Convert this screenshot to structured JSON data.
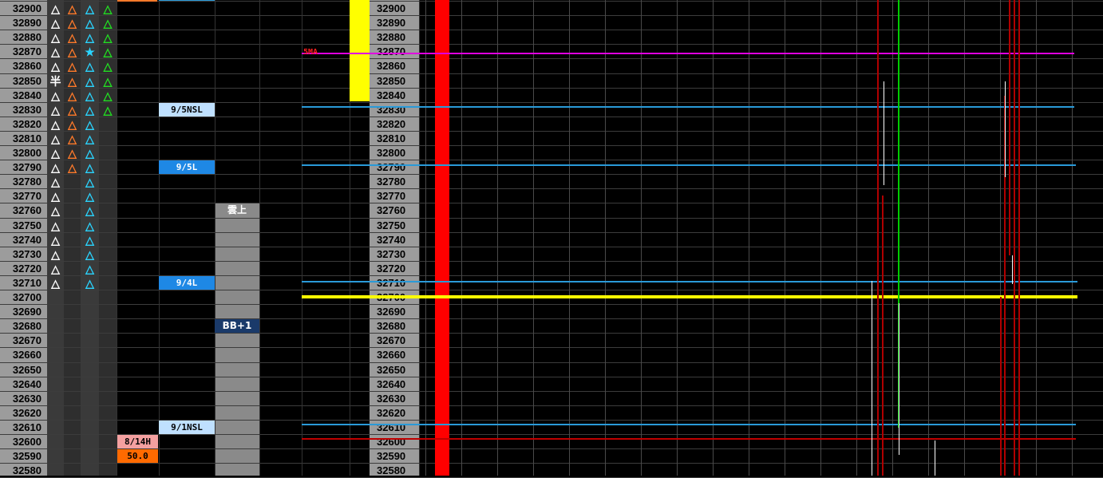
{
  "price_ladder": {
    "prices": [
      "32900",
      "32890",
      "32880",
      "32870",
      "32860",
      "32850",
      "32840",
      "32830",
      "32820",
      "32810",
      "32800",
      "32790",
      "32780",
      "32770",
      "32760",
      "32750",
      "32740",
      "32730",
      "32720",
      "32710",
      "32700",
      "32690",
      "32680",
      "32670",
      "32660",
      "32650",
      "32640",
      "32630",
      "32620",
      "32610",
      "32600",
      "32590",
      "32580"
    ]
  },
  "signal_columns": {
    "white": [
      "△",
      "△",
      "△",
      "△",
      "△",
      "半",
      "△",
      "△",
      "△",
      "△",
      "△",
      "△",
      "△",
      "△",
      "△",
      "△",
      "△",
      "△",
      "△",
      "△"
    ],
    "orange": [
      "△",
      "△",
      "△",
      "△",
      "△",
      "△",
      "△",
      "△",
      "△",
      "△",
      "△",
      "△"
    ],
    "cyan": [
      "△",
      "△",
      "△",
      "★",
      "△",
      "△",
      "△",
      "△",
      "△",
      "△",
      "△",
      "△",
      "△",
      "△",
      "△",
      "△",
      "△",
      "△",
      "△",
      "△"
    ],
    "green": [
      "△",
      "△",
      "△",
      "△",
      "△",
      "△",
      "△",
      "△"
    ],
    "colors": {
      "white": "#ffffff",
      "orange": "#ff7a2a",
      "cyan": "#2ad4ff",
      "green": "#22dd22"
    }
  },
  "level_tags": [
    {
      "text": "9/5NSL",
      "price": "32830",
      "bg": "#bfe0ff",
      "fg": "#000000"
    },
    {
      "text": "9/5L",
      "price": "32790",
      "bg": "#1e88e5",
      "fg": "#ffffff"
    },
    {
      "text": "9/4L",
      "price": "32710",
      "bg": "#1e88e5",
      "fg": "#ffffff"
    },
    {
      "text": "9/1NSL",
      "price": "32610",
      "bg": "#bfe0ff",
      "fg": "#000000"
    },
    {
      "text": "8/14H",
      "price": "32600",
      "bg": "#f4a0a0",
      "fg": "#000000"
    },
    {
      "text": "50.0",
      "price": "32590",
      "bg": "#ff6a00",
      "fg": "#000000"
    }
  ],
  "cloud_labels": [
    {
      "text": "雲上",
      "price": "32760"
    },
    {
      "text": "BB+1",
      "price": "32680"
    }
  ],
  "chart_lines": {
    "ma_label": "5MA",
    "ma_price": "32870",
    "colors": {
      "ma": "#e000e0",
      "blue": "#2a9ad8",
      "yellow": "#ffff00",
      "darkred": "#c00000",
      "green": "#00cc00",
      "redbar": "#ff0000"
    }
  }
}
